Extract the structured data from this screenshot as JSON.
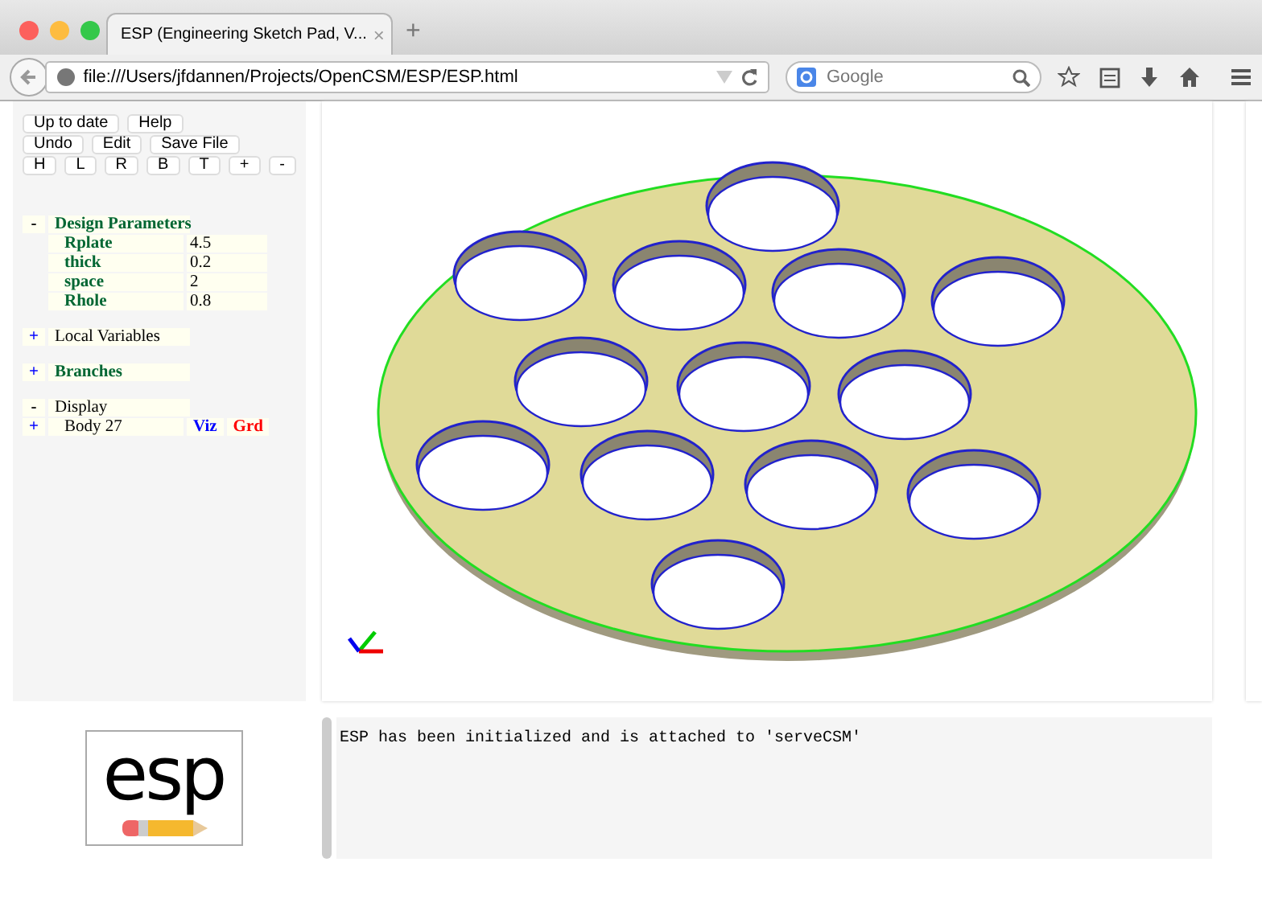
{
  "browser": {
    "tab_title": "ESP (Engineering Sketch Pad, V...",
    "tab_close": "×",
    "new_tab": "+",
    "url": "file:///Users/jfdannen/Projects/OpenCSM/ESP/ESP.html",
    "search_placeholder": "Google"
  },
  "button_rows": [
    [
      "Up to date",
      "Help"
    ],
    [
      "Undo",
      "Edit",
      "Save File"
    ],
    [
      "H",
      "L",
      "R",
      "B",
      "T",
      "+",
      "-"
    ]
  ],
  "tree": [
    {
      "sign": "-",
      "label": "Design Parameters",
      "highlighted": true,
      "children": [
        {
          "name": "Rplate",
          "value": "4.5"
        },
        {
          "name": "thick",
          "value": "0.2"
        },
        {
          "name": "space",
          "value": "2"
        },
        {
          "name": "Rhole",
          "value": "0.8"
        }
      ]
    },
    {
      "sign": "+",
      "label": "Local Variables",
      "highlighted": false
    },
    {
      "sign": "+",
      "label": "Branches",
      "highlighted": true
    },
    {
      "sign": "-",
      "label": "Display",
      "highlighted": false,
      "bodies": [
        {
          "sign": "+",
          "label": "Body 27",
          "toggles": [
            {
              "label": "Viz",
              "color": "#0000ff"
            },
            {
              "label": "Grd",
              "color": "#ff0000"
            }
          ]
        }
      ]
    }
  ],
  "logo": {
    "text": "esp"
  },
  "message": "ESP has been initialized and is attached to 'serveCSM'"
}
